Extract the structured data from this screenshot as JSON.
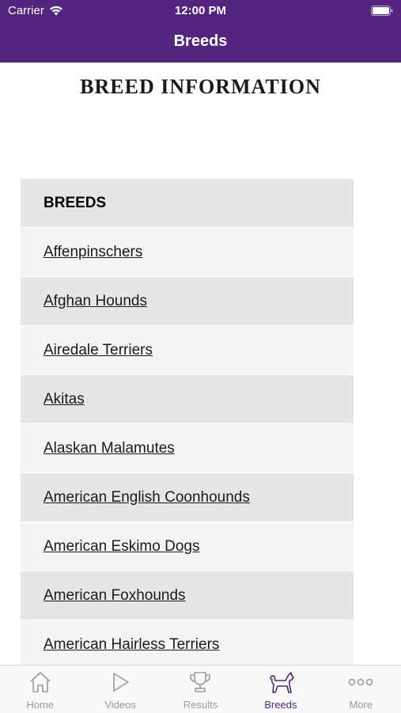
{
  "status_bar": {
    "carrier": "Carrier",
    "time": "12:00 PM"
  },
  "nav": {
    "title": "Breeds"
  },
  "page": {
    "heading": "BREED INFORMATION"
  },
  "breeds": {
    "header": "BREEDS",
    "items": [
      "Affenpinschers",
      "Afghan Hounds",
      "Airedale Terriers",
      "Akitas",
      "Alaskan Malamutes",
      "American English Coonhounds",
      "American Eskimo Dogs",
      "American Foxhounds",
      "American Hairless Terriers"
    ]
  },
  "tabs": [
    {
      "label": "Home",
      "icon": "home-icon",
      "active": false
    },
    {
      "label": "Videos",
      "icon": "play-icon",
      "active": false
    },
    {
      "label": "Results",
      "icon": "trophy-icon",
      "active": false
    },
    {
      "label": "Breeds",
      "icon": "dog-icon",
      "active": true
    },
    {
      "label": "More",
      "icon": "more-icon",
      "active": false
    }
  ],
  "colors": {
    "brand": "#53257f",
    "tab_inactive": "#9b9b9b"
  }
}
